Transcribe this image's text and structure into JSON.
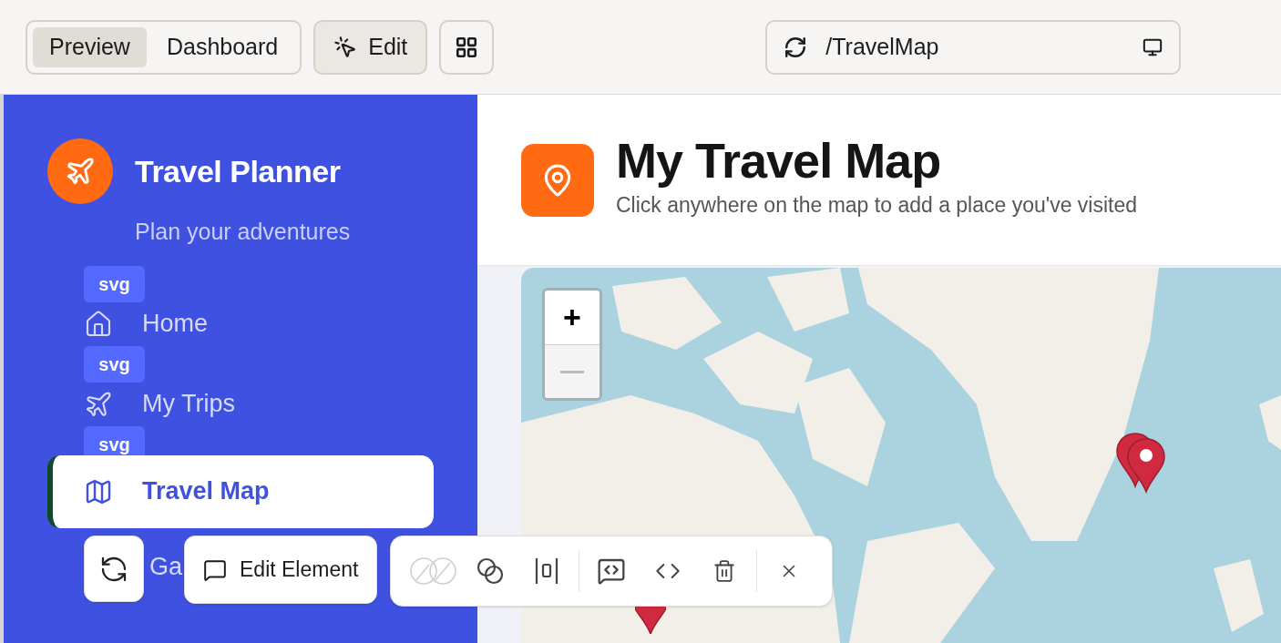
{
  "toolbar": {
    "view_tabs": [
      {
        "label": "Preview",
        "selected": true
      },
      {
        "label": "Dashboard",
        "selected": false
      }
    ],
    "edit_button": {
      "label": "Edit",
      "selected": true
    },
    "url": "/TravelMap"
  },
  "sidebar": {
    "title": "Travel Planner",
    "subtitle": "Plan your adventures",
    "items": [
      {
        "label": "Home",
        "badge": "svg",
        "selected": false
      },
      {
        "label": "My Trips",
        "badge": "svg",
        "selected": false
      },
      {
        "label": "Travel Map",
        "badge": "svg",
        "selected": true
      },
      {
        "label": "Ga",
        "selected": false
      }
    ]
  },
  "page": {
    "title": "My Travel Map",
    "subtitle": "Click anywhere on the map to add a place you've visited"
  },
  "map": {
    "zoom_in": "+",
    "zoom_out_disabled": true
  },
  "element_menu": {
    "edit_label": "Edit Element",
    "tools": [
      {
        "kind": "unlink",
        "disabled": true
      },
      {
        "kind": "overlap",
        "disabled": false
      },
      {
        "kind": "spacing",
        "disabled": false
      },
      {
        "kind": "divider"
      },
      {
        "kind": "code-comment",
        "disabled": false
      },
      {
        "kind": "code",
        "disabled": false
      },
      {
        "kind": "delete",
        "disabled": false
      },
      {
        "kind": "divider"
      },
      {
        "kind": "close",
        "disabled": false
      }
    ]
  }
}
